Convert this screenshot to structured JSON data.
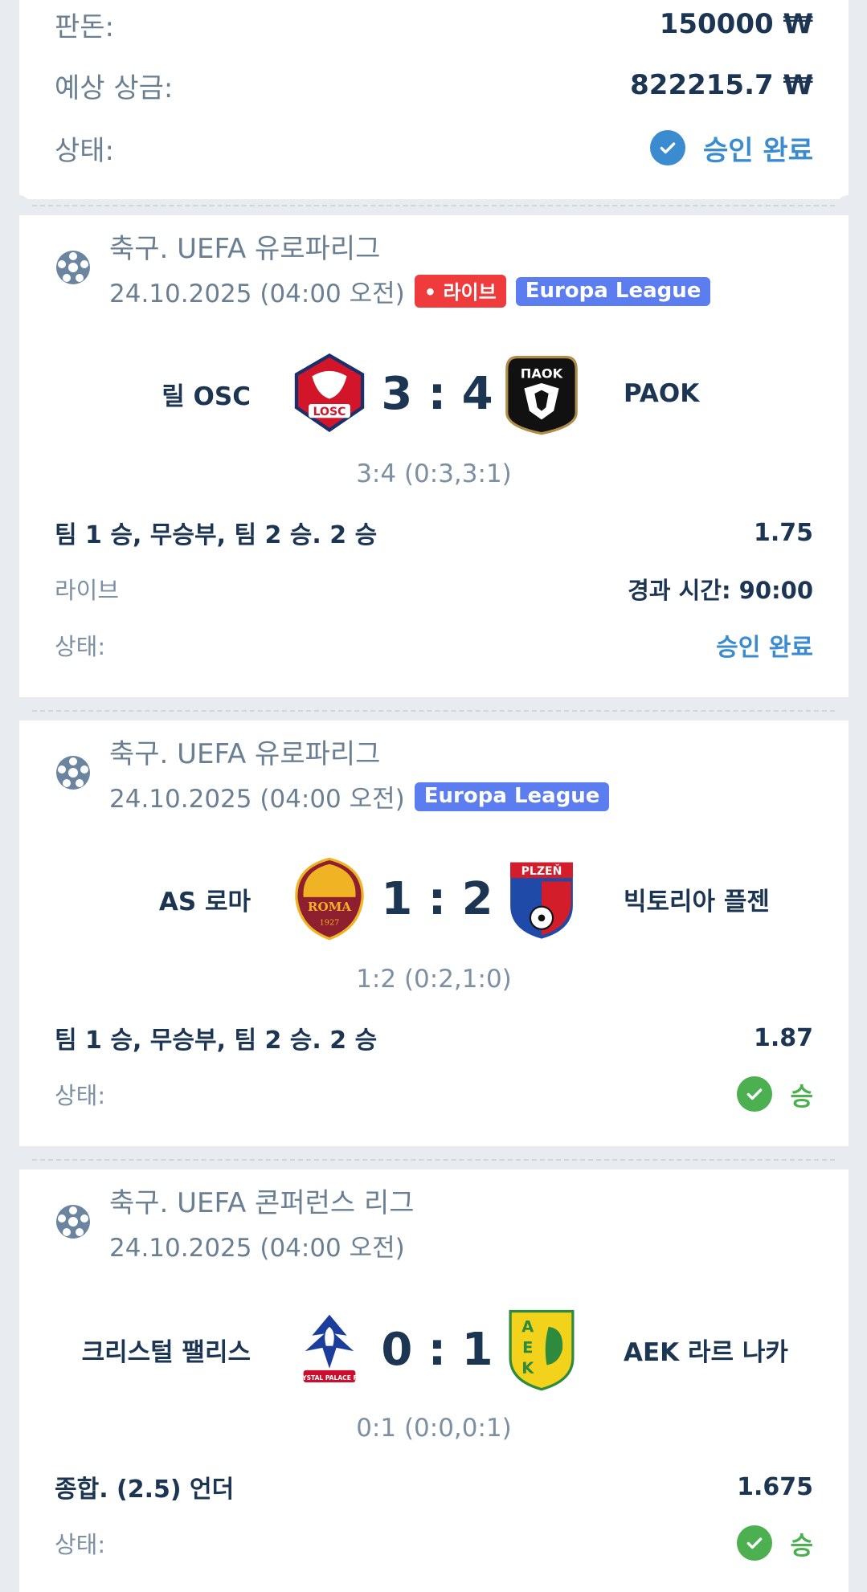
{
  "summary": {
    "stake_label": "판돈:",
    "stake_value": "150000 ₩",
    "payout_label": "예상 상금:",
    "payout_value": "822215.7 ₩",
    "status_label": "상태:",
    "status_value": "승인 완료",
    "status_color": "#3b8bd1"
  },
  "events": [
    {
      "league": "축구. UEFA 유로파리그",
      "date": "24.10.2025 (04:00 오전)",
      "live_badge": "• 라이브",
      "competition_badge": "Europa League",
      "team1": "릴 OSC",
      "team2": "PAOK",
      "team1_logo": "losc-logo",
      "team2_logo": "paok-logo",
      "score": "3 : 4",
      "score_detail": "3:4 (0:3,3:1)",
      "bet": "팀 1 승, 무승부, 팀 2 승. 2 승",
      "coef": "1.75",
      "live_label": "라이브",
      "elapsed": "경과 시간: 90:00",
      "status_label": "상태:",
      "status": "승인 완료"
    },
    {
      "league": "축구. UEFA 유로파리그",
      "date": "24.10.2025 (04:00 오전)",
      "competition_badge": "Europa League",
      "team1": "AS 로마",
      "team2": "빅토리아 플젠",
      "team1_logo": "roma-logo",
      "team2_logo": "viktoria-plzen-logo",
      "score": "1 : 2",
      "score_detail": "1:2 (0:2,1:0)",
      "bet": "팀 1 승, 무승부, 팀 2 승. 2 승",
      "coef": "1.87",
      "status_label": "상태:",
      "status": "승",
      "status_color": "#4caf50"
    },
    {
      "league": "축구. UEFA 콘퍼런스 리그",
      "date": "24.10.2025 (04:00 오전)",
      "team1": "크리스털 팰리스",
      "team2": "AEK 라르 나카",
      "team1_logo": "crystal-palace-logo",
      "team2_logo": "aek-larnaca-logo",
      "score": "0 : 1",
      "score_detail": "0:1 (0:0,0:1)",
      "bet": "종합. (2.5) 언더",
      "coef": "1.675",
      "status_label": "상태:",
      "status": "승",
      "status_color": "#4caf50"
    }
  ]
}
